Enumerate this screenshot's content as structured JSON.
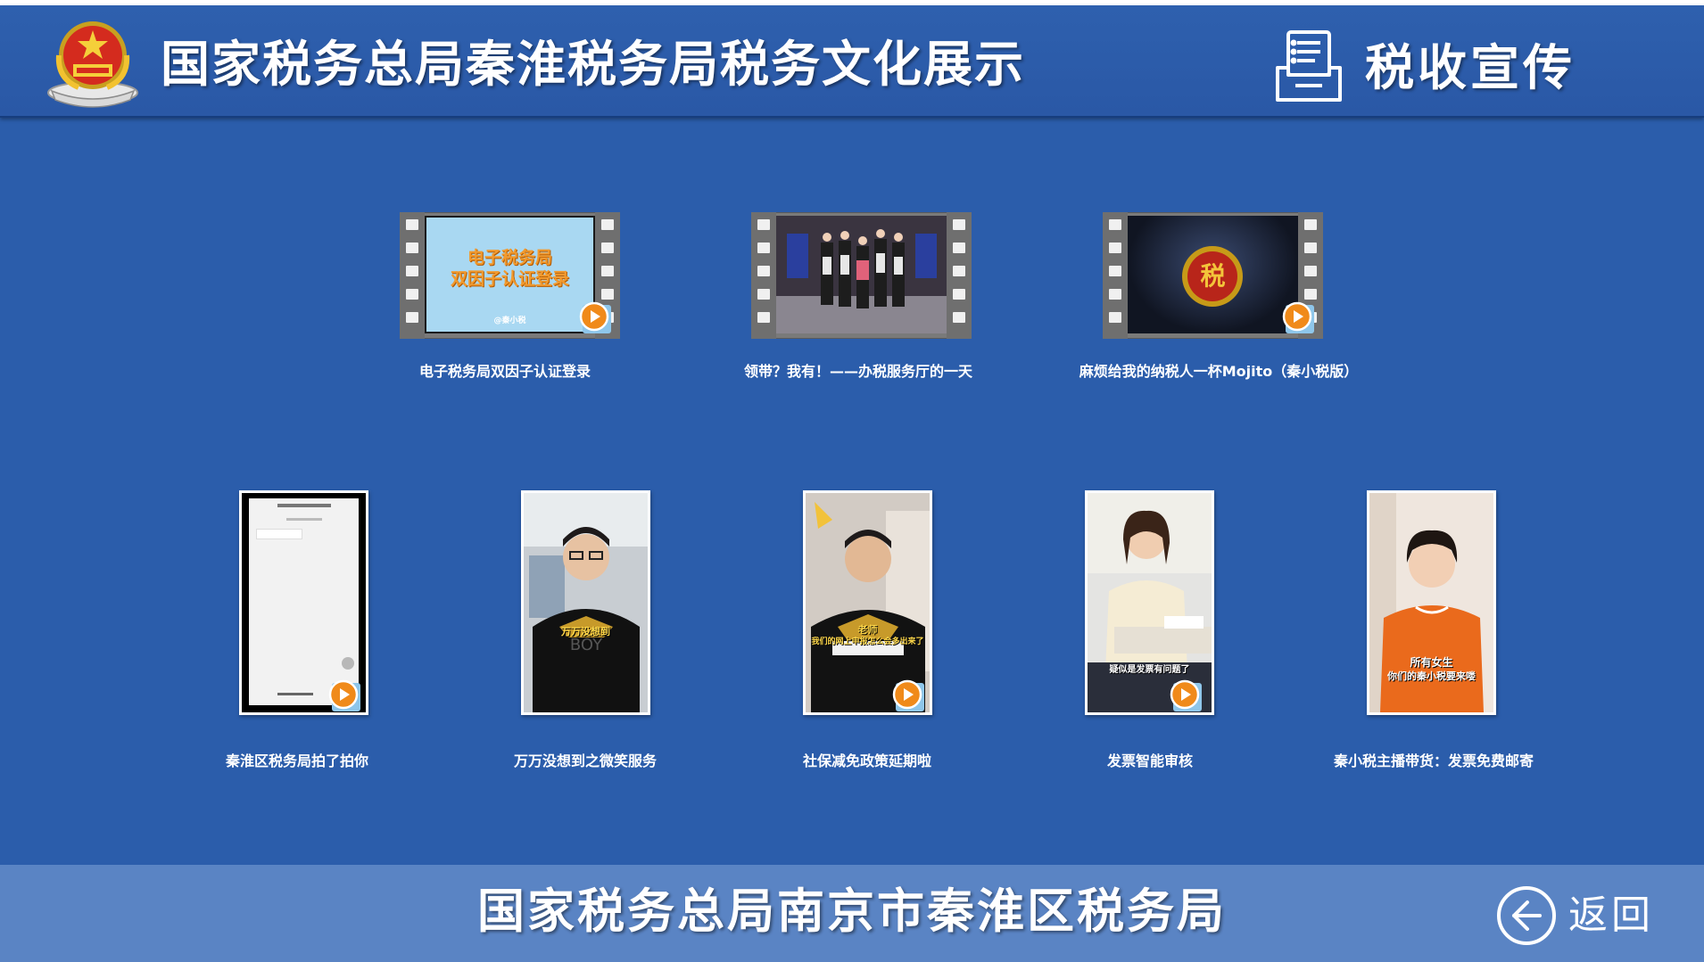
{
  "header": {
    "title": "国家税务总局秦淮税务局税务文化展示",
    "section_title": "税收宣传"
  },
  "videos_row1": [
    {
      "caption": "电子税务局双因子认证登录",
      "thumb_text_1": "电子税务局",
      "thumb_text_2": "双因子认证登录",
      "thumb_small": "@秦小税"
    },
    {
      "caption": "领带？我有！——办税服务厅的一天"
    },
    {
      "caption": "麻烦给我的纳税人一杯Mojito（秦小税版）",
      "thumb_text_1": "税"
    }
  ],
  "videos_row2": [
    {
      "caption": "秦淮区税务局拍了拍你"
    },
    {
      "caption": "万万没想到之微笑服务",
      "thumb_text_1": "万万没想到"
    },
    {
      "caption": "社保减免政策延期啦",
      "thumb_text_1": "老师",
      "thumb_text_2": "我们的网上申报怎么会多出来了"
    },
    {
      "caption": "发票智能审核",
      "thumb_text_1": "疑似是发票有问题了"
    },
    {
      "caption": "秦小税主播带货：发票免费邮寄",
      "thumb_text_1": "所有女生",
      "thumb_text_2": "你们的秦小税要来喽"
    }
  ],
  "footer": {
    "title": "国家税务总局南京市秦淮区税务局",
    "back_label": "返回"
  },
  "colors": {
    "background": "#2b5dab",
    "footer": "#5a84c4",
    "play_orange": "#f08a1a"
  }
}
